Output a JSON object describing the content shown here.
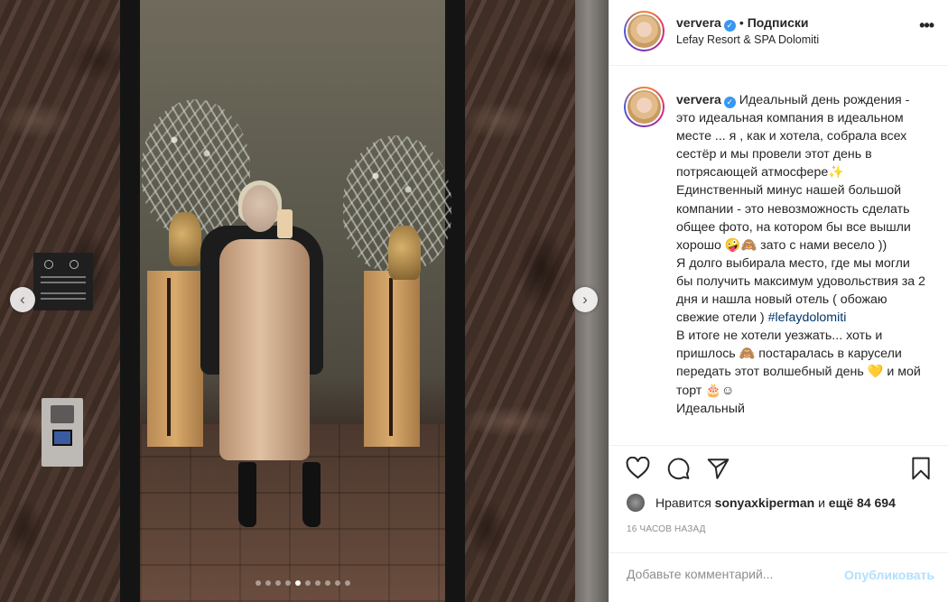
{
  "post": {
    "username": "ververa",
    "separator": "•",
    "follow_label": "Подписки",
    "location": "Lefay Resort & SPA Dolomiti",
    "more_icon": "more-horizontal-icon"
  },
  "caption": {
    "username": "ververa",
    "text_1": "Идеальный день рождения - это идеальная компания в идеальном месте ... я , как и хотела, собрала всех сестёр и мы провели этот день в потрясающей атмосфере✨ Единственный минус нашей большой компании - это невозможность сделать общее фото, на котором бы все вышли хорошо 🤪🙈 зато с нами весело ))",
    "text_2": "Я долго выбирала место, где мы могли бы получить максимум удовольствия за 2 дня и нашла новый отель ( обожаю свежие отели ) ",
    "hashtag": "#lefaydolomiti",
    "text_3": "В итоге не хотели уезжать... хоть и пришлось 🙈 постаралась в карусели передать этот волшебный день 💛 и мой торт 🎂☺",
    "text_4": "Идеальный"
  },
  "likes": {
    "prefix": "Нравится",
    "user": "sonyaxkiperman",
    "connector": "и",
    "count": "ещё 84 694"
  },
  "timestamp": "16 ЧАСОВ НАЗАД",
  "comment": {
    "placeholder": "Добавьте комментарий...",
    "post_label": "Опубликовать"
  },
  "carousel": {
    "prev_glyph": "‹",
    "next_glyph": "›",
    "total_slides": 10,
    "active_slide": 5
  },
  "icons": {
    "like": "heart-icon",
    "comment": "comment-icon",
    "share": "share-icon",
    "save": "bookmark-icon",
    "verified": "verified-badge-icon"
  },
  "colors": {
    "link": "#00376b",
    "verified": "#3897f0",
    "post_button": "#b2dffc",
    "muted": "#8e8e8e"
  }
}
